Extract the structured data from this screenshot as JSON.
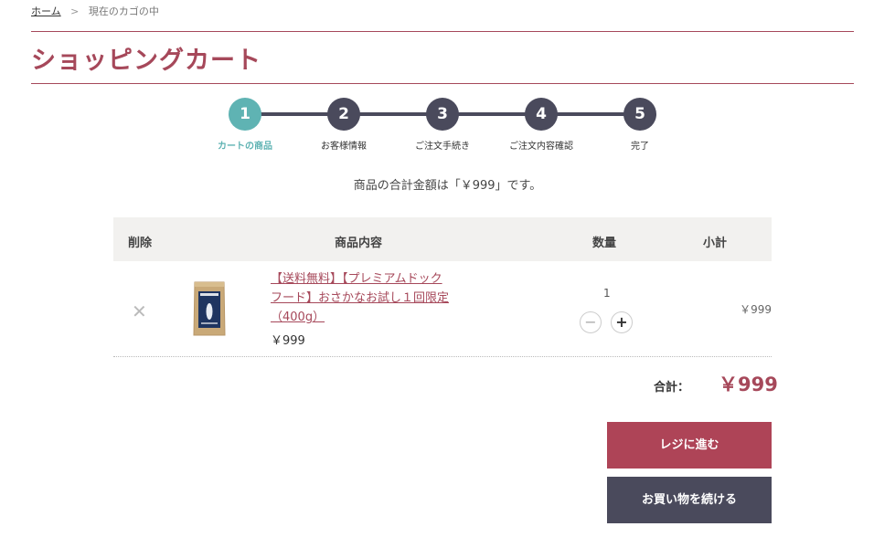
{
  "breadcrumb": {
    "home": "ホーム",
    "separator": ">",
    "current": "現在のカゴの中"
  },
  "page_title": "ショッピングカート",
  "steps": [
    {
      "num": "1",
      "label": "カートの商品",
      "active": true
    },
    {
      "num": "2",
      "label": "お客様情報"
    },
    {
      "num": "3",
      "label": "ご注文手続き"
    },
    {
      "num": "4",
      "label": "ご注文内容確認"
    },
    {
      "num": "5",
      "label": "完了"
    }
  ],
  "total_message": "商品の合計金額は「￥999」です。",
  "table": {
    "headers": {
      "delete": "削除",
      "product": "商品内容",
      "qty": "数量",
      "subtotal": "小計"
    },
    "items": [
      {
        "remove": "✕",
        "name": "【送料無料】【プレミアムドックフード】おさかなお試し１回限定（400g）",
        "price": "￥999",
        "quantity": "1",
        "minus": "−",
        "plus": "+",
        "subtotal": "￥999"
      }
    ]
  },
  "summary": {
    "label": "合計：",
    "value": "￥999"
  },
  "buttons": {
    "checkout": "レジに進む",
    "continue": "お買い物を続ける"
  },
  "colors": {
    "accent": "#a6485a",
    "active_step": "#5fb3b3",
    "dark": "#4a4a5c",
    "checkout_bg": "#ae4457"
  }
}
